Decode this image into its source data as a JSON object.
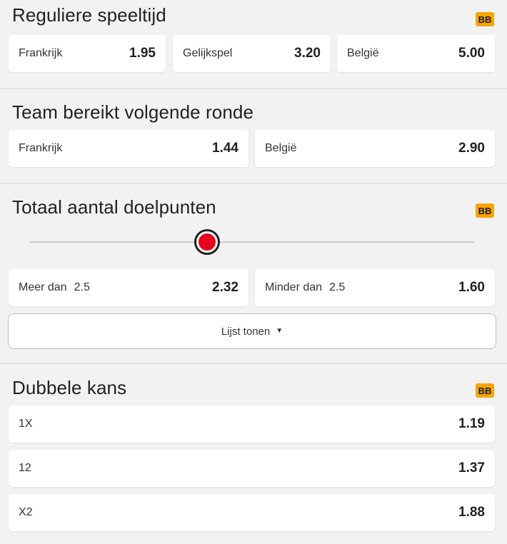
{
  "sections": {
    "regular": {
      "title": "Reguliere speeltijd",
      "badge": "BB",
      "odds": [
        {
          "label": "Frankrijk",
          "value": "1.95"
        },
        {
          "label": "Gelijkspel",
          "value": "3.20"
        },
        {
          "label": "België",
          "value": "5.00"
        }
      ]
    },
    "next_round": {
      "title": "Team bereikt volgende ronde",
      "odds": [
        {
          "label": "Frankrijk",
          "value": "1.44"
        },
        {
          "label": "België",
          "value": "2.90"
        }
      ]
    },
    "total_goals": {
      "title": "Totaal aantal doelpunten",
      "badge": "BB",
      "slider": {
        "selected_line": "2.5"
      },
      "odds": [
        {
          "label": "Meer dan",
          "line": "2.5",
          "value": "2.32"
        },
        {
          "label": "Minder dan",
          "line": "2.5",
          "value": "1.60"
        }
      ],
      "list_button": "Lijst tonen",
      "list_button_icon": "chevron-down-icon"
    },
    "double_chance": {
      "title": "Dubbele kans",
      "badge": "BB",
      "odds": [
        {
          "label": "1X",
          "value": "1.19"
        },
        {
          "label": "12",
          "value": "1.37"
        },
        {
          "label": "X2",
          "value": "1.88"
        }
      ]
    }
  },
  "colors": {
    "badge": "#f7a600",
    "slider_thumb": "#e8001c",
    "background": "#f2f2f2",
    "card": "#ffffff"
  }
}
